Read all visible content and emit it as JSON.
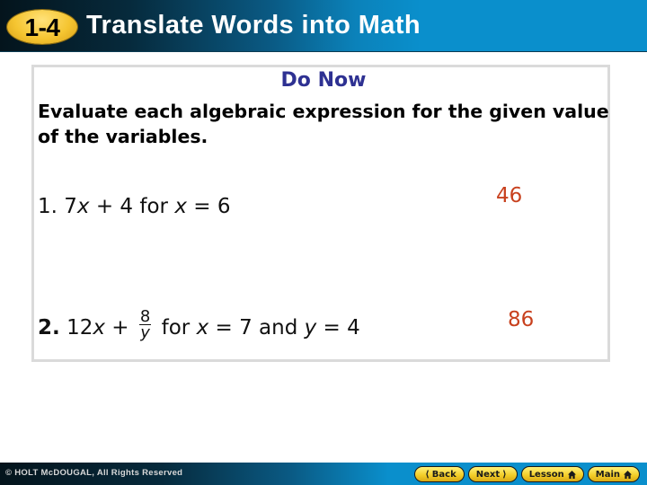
{
  "header": {
    "lesson_number": "1-4",
    "title": "Translate Words into Math"
  },
  "content": {
    "heading": "Do Now",
    "instructions": "Evaluate each algebraic expression for the given value of the variables.",
    "problems": [
      {
        "number": "1.",
        "expr_parts": [
          "7",
          "x",
          " + 4 for ",
          "x",
          " = 6"
        ],
        "answer": "46"
      },
      {
        "number": "2.",
        "expr_parts": [
          "12",
          "x",
          " + "
        ],
        "fraction": {
          "numerator": "8",
          "denominator": "y"
        },
        "expr_tail": [
          " for ",
          "x",
          " = 7 and ",
          "y",
          " = 4"
        ],
        "answer": "86"
      }
    ],
    "answer_color": "#c8411e",
    "heading_color": "#2e3192"
  },
  "footer": {
    "copyright": "© HOLT McDOUGAL, All Rights Reserved",
    "nav": {
      "back": "Back",
      "next": "Next",
      "lesson": "Lesson",
      "main": "Main"
    }
  }
}
